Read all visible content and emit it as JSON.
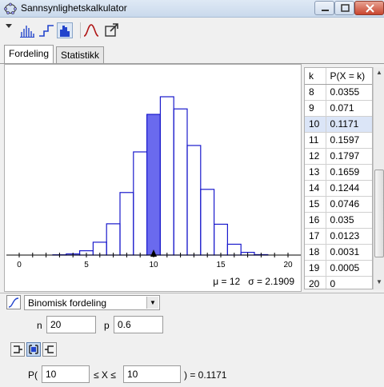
{
  "window": {
    "title": "Sannsynlighetskalkulator"
  },
  "toolbar": {
    "buttons": [
      {
        "name": "bar-graph-icon"
      },
      {
        "name": "step-graph-icon"
      },
      {
        "name": "histogram-icon"
      },
      {
        "name": "normal-overlay-icon"
      },
      {
        "name": "export-icon"
      }
    ]
  },
  "tabs": [
    {
      "label": "Fordeling",
      "active": true
    },
    {
      "label": "Statistikk",
      "active": false
    }
  ],
  "chart_data": {
    "type": "bar",
    "x_ticks": [
      "0",
      "5",
      "10",
      "15",
      "20"
    ],
    "xlim": [
      -1,
      20.5
    ],
    "categories": [
      0,
      1,
      2,
      3,
      4,
      5,
      6,
      7,
      8,
      9,
      10,
      11,
      12,
      13,
      14,
      15,
      16,
      17,
      18,
      19,
      20
    ],
    "values": [
      0,
      0,
      0,
      0.0003,
      0.0013,
      0.0049,
      0.0146,
      0.0355,
      0.071,
      0.1171,
      0.1597,
      0.1797,
      0.1659,
      0.1244,
      0.0746,
      0.035,
      0.0123,
      0.0031,
      0.0005,
      0.0,
      0.0
    ],
    "highlighted_category": 10,
    "colors": {
      "outline": "#1a1acc",
      "highlight_fill": "#6a6aee"
    },
    "stats": {
      "mu_label": "μ = 12",
      "sigma_label": "σ = 2.1909"
    }
  },
  "table": {
    "headers": [
      "k",
      "P(X = k)"
    ],
    "rows": [
      [
        "8",
        "0.0355"
      ],
      [
        "9",
        "0.071"
      ],
      [
        "10",
        "0.1171"
      ],
      [
        "11",
        "0.1597"
      ],
      [
        "12",
        "0.1797"
      ],
      [
        "13",
        "0.1659"
      ],
      [
        "14",
        "0.1244"
      ],
      [
        "15",
        "0.0746"
      ],
      [
        "16",
        "0.035"
      ],
      [
        "17",
        "0.0123"
      ],
      [
        "18",
        "0.0031"
      ],
      [
        "19",
        "0.0005"
      ],
      [
        "20",
        "0"
      ]
    ],
    "highlighted_row": "10"
  },
  "distribution": {
    "selected": "Binomisk fordeling",
    "n_label": "n",
    "n_value": "20",
    "p_label": "p",
    "p_value": "0.6"
  },
  "interval": {
    "p_open": "P(",
    "lower": "10",
    "middle": "≤ X ≤",
    "upper": "10",
    "result": ") =  0.1171"
  }
}
